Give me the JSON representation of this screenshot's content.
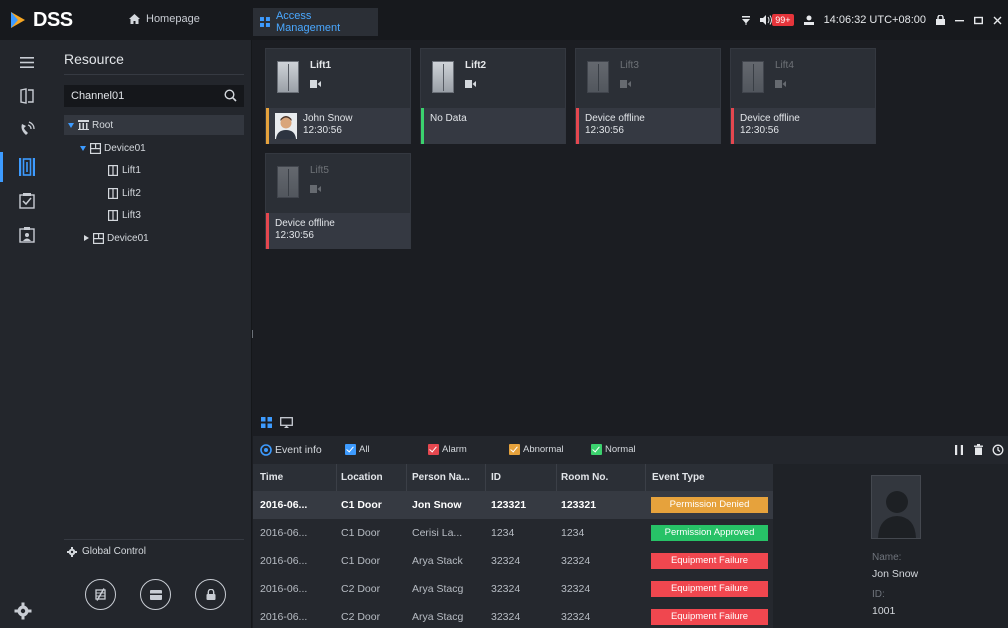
{
  "app": {
    "logo_text": "DSS",
    "home_tab": "Homepage",
    "active_tab": "Access Management"
  },
  "topbar": {
    "badge": "99+",
    "time": "14:06:32 UTC+08:00"
  },
  "resource": {
    "title": "Resource",
    "search_value": "Channel01",
    "tree": [
      {
        "label": "Root",
        "level": 0,
        "expanded": true
      },
      {
        "label": "Device01",
        "level": 1,
        "expanded": true
      },
      {
        "label": "Lift1",
        "level": 2
      },
      {
        "label": "Lift2",
        "level": 2
      },
      {
        "label": "Lift3",
        "level": 2
      },
      {
        "label": "Device01",
        "level": 1,
        "expanded": false
      }
    ],
    "global_control": "Global Control"
  },
  "lifts": [
    {
      "name": "Lift1",
      "status": "John Snow",
      "time": "12:30:56",
      "color": "#e6a23c",
      "online": true,
      "avatar": true
    },
    {
      "name": "Lift2",
      "status": "No Data",
      "time": "",
      "color": "#3bd26e",
      "online": true,
      "avatar": false
    },
    {
      "name": "Lift3",
      "status": "Device offline",
      "time": "12:30:56",
      "color": "#e5474f",
      "online": false,
      "avatar": false
    },
    {
      "name": "Lift4",
      "status": "Device offline",
      "time": "12:30:56",
      "color": "#e5474f",
      "online": false,
      "avatar": false
    },
    {
      "name": "Lift5",
      "status": "Device offline",
      "time": "12:30:56",
      "color": "#e5474f",
      "online": false,
      "avatar": false
    }
  ],
  "event_bar": {
    "title": "Event info",
    "filters": [
      {
        "label": "All",
        "color": "#3d9bff"
      },
      {
        "label": "Alarm",
        "color": "#e5474f"
      },
      {
        "label": "Abnormal",
        "color": "#e6a23c"
      },
      {
        "label": "Normal",
        "color": "#3bd26e"
      }
    ]
  },
  "table": {
    "columns": [
      "Time",
      "Location",
      "Person Na...",
      "ID",
      "Room No.",
      "Event Type"
    ],
    "rows": [
      {
        "time": "2016-06...",
        "location": "C1 Door",
        "person": "Jon Snow",
        "id": "123321",
        "room": "123321",
        "event": "Permission Denied",
        "event_color": "#e6a23c"
      },
      {
        "time": "2016-06...",
        "location": "C1 Door",
        "person": "Cerisi La...",
        "id": "1234",
        "room": "1234",
        "event": "Permission Approved",
        "event_color": "#27c267"
      },
      {
        "time": "2016-06...",
        "location": "C1 Door",
        "person": "Arya Stack",
        "id": "32324",
        "room": "32324",
        "event": "Equipment Failure",
        "event_color": "#f0474f"
      },
      {
        "time": "2016-06...",
        "location": "C2 Door",
        "person": "Arya Stacg",
        "id": "32324",
        "room": "32324",
        "event": "Equipment Failure",
        "event_color": "#f0474f"
      },
      {
        "time": "2016-06...",
        "location": "C2 Door",
        "person": "Arya Stacg",
        "id": "32324",
        "room": "32324",
        "event": "Equipment Failure",
        "event_color": "#f0474f"
      }
    ]
  },
  "person": {
    "name_label": "Name:",
    "name": "Jon Snow",
    "id_label": "ID:",
    "id": "1001"
  }
}
